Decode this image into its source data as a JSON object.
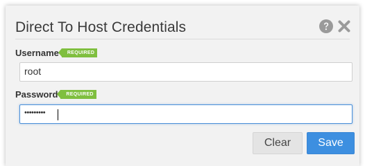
{
  "dialog": {
    "title": "Direct To Host Credentials",
    "help_icon": "question-circle-icon",
    "close_icon": "close-x-icon"
  },
  "fields": {
    "username": {
      "label": "Username",
      "badge": "REQUIRED",
      "value": "root"
    },
    "password": {
      "label": "Password",
      "badge": "REQUIRED",
      "value": "•••••••••"
    }
  },
  "buttons": {
    "clear_label": "Clear",
    "save_label": "Save"
  },
  "colors": {
    "required_badge": "#7fbf3f",
    "primary_button": "#3d8fe0",
    "focus_border": "#4a90d9"
  }
}
